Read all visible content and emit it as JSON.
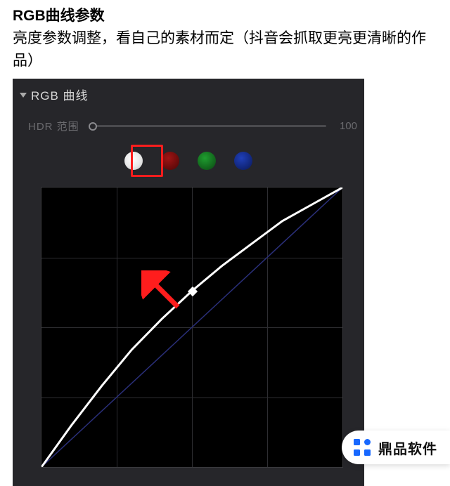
{
  "header": {
    "title": "RGB曲线参数",
    "subtitle": "亮度参数调整，看自己的素材而定（抖音会抓取更亮更清晰的作品）"
  },
  "panel": {
    "section_label": "RGB 曲线",
    "hdr_label": "HDR 范围",
    "hdr_value": "100",
    "channels": {
      "selected": "white",
      "order": [
        "white",
        "red",
        "green",
        "blue"
      ]
    }
  },
  "chart_data": {
    "type": "line",
    "title": "RGB 曲线",
    "xlabel": "",
    "ylabel": "",
    "xlim": [
      0,
      1
    ],
    "ylim": [
      0,
      1
    ],
    "grid": true,
    "series": [
      {
        "name": "baseline",
        "color": "#2a2f7a",
        "values": [
          [
            0,
            0
          ],
          [
            1,
            1
          ]
        ]
      },
      {
        "name": "white-curve",
        "color": "#ffffff",
        "values": [
          [
            0.0,
            0.0
          ],
          [
            0.1,
            0.15
          ],
          [
            0.2,
            0.29
          ],
          [
            0.3,
            0.42
          ],
          [
            0.4,
            0.53
          ],
          [
            0.5,
            0.63
          ],
          [
            0.6,
            0.72
          ],
          [
            0.7,
            0.8
          ],
          [
            0.8,
            0.88
          ],
          [
            0.9,
            0.94
          ],
          [
            1.0,
            1.0
          ]
        ]
      }
    ],
    "control_point": [
      0.5,
      0.63
    ],
    "annotation_arrow": {
      "from": [
        0.52,
        0.55
      ],
      "to": [
        0.4,
        0.68
      ],
      "color": "#ff1d1d"
    }
  },
  "watermark": {
    "text": "鼎品软件"
  }
}
